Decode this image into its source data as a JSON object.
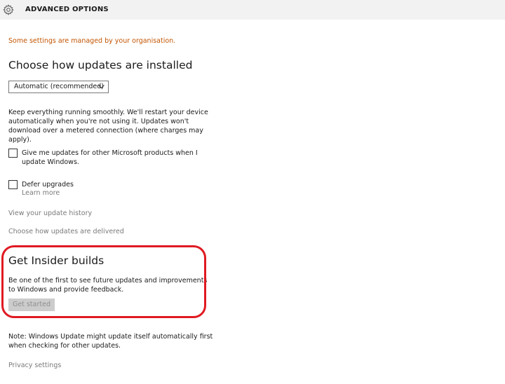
{
  "window": {
    "title": "ADVANCED OPTIONS",
    "icon": "gear-icon"
  },
  "notice": {
    "managed": "Some settings are managed by your organisation.",
    "color": "#c25400"
  },
  "install": {
    "heading": "Choose how updates are installed",
    "dropdown_value": "Automatic (recommended)",
    "description": "Keep everything running smoothly. We'll restart your device automatically when you're not using it. Updates won't download over a metered connection (where charges may apply)."
  },
  "options": {
    "ms_updates_label": "Give me updates for other Microsoft products when I update Windows.",
    "ms_updates_checked": false,
    "defer_label": "Defer upgrades",
    "defer_checked": false,
    "learn_more": "Learn more"
  },
  "links": {
    "history": "View your update history",
    "delivery": "Choose how updates are delivered",
    "privacy": "Privacy settings"
  },
  "insider": {
    "heading": "Get Insider builds",
    "description": "Be one of the first to see future updates and improvements to Windows and provide feedback.",
    "button": "Get started",
    "highlight_color": "#e01a22"
  },
  "note": {
    "text": "Note: Windows Update might update itself automatically first when checking for other updates."
  }
}
